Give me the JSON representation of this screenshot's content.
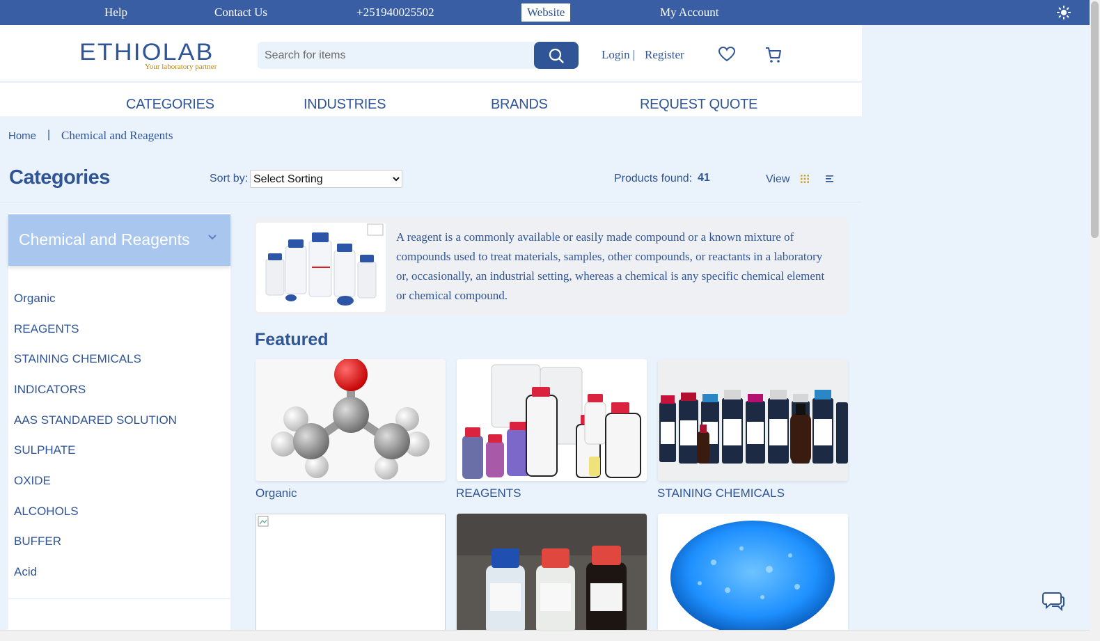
{
  "topbar": {
    "help": "Help",
    "contact": "Contact Us",
    "phone": "+251940025502",
    "website": "Website",
    "account": "My Account",
    "theme_icon": "sun-icon"
  },
  "header": {
    "logo": "ETHIOLAB",
    "tagline": "Your laboratory partner",
    "search_placeholder": "Search for items",
    "login": "Login |",
    "register": "Register"
  },
  "nav": {
    "categories": "CATEGORIES",
    "industries": "INDUSTRIES",
    "brands": "BRANDS",
    "request_quote": "REQUEST QUOTE"
  },
  "breadcrumb": {
    "home": "Home",
    "separator": "|",
    "current": "Chemical and Reagents"
  },
  "toolbar": {
    "title": "Categories",
    "sort_label": "Sort by:",
    "sort_selected": "Select Sorting",
    "found_label": "Products found:",
    "found_count": "41",
    "view_label": "View"
  },
  "sidebar": {
    "heading": "Chemical and Reagents",
    "items": [
      {
        "label": "Organic"
      },
      {
        "label": "REAGENTS"
      },
      {
        "label": "STAINING CHEMICALS"
      },
      {
        "label": "INDICATORS"
      },
      {
        "label": "AAS STANDARED SOLUTION"
      },
      {
        "label": "SULPHATE"
      },
      {
        "label": "OXIDE"
      },
      {
        "label": "ALCOHOLS"
      },
      {
        "label": "BUFFER"
      },
      {
        "label": "Acid"
      }
    ]
  },
  "intro": {
    "text": "A reagent is a commonly available or easily made compound or a known mixture of compounds used to treat materials, samples, other compounds, or reactants in a laboratory or, occasionally, an industrial setting, whereas a chemical is any specific chemical element or chemical compound."
  },
  "featured": {
    "heading": "Featured",
    "cards": [
      {
        "label": "Organic"
      },
      {
        "label": "REAGENTS"
      },
      {
        "label": "STAINING CHEMICALS"
      }
    ]
  },
  "colors": {
    "primary": "#2f5597",
    "topbar": "#3a5ea3",
    "page_bg": "#eaf2fb",
    "sidebar_head": "#a9c6ee"
  }
}
